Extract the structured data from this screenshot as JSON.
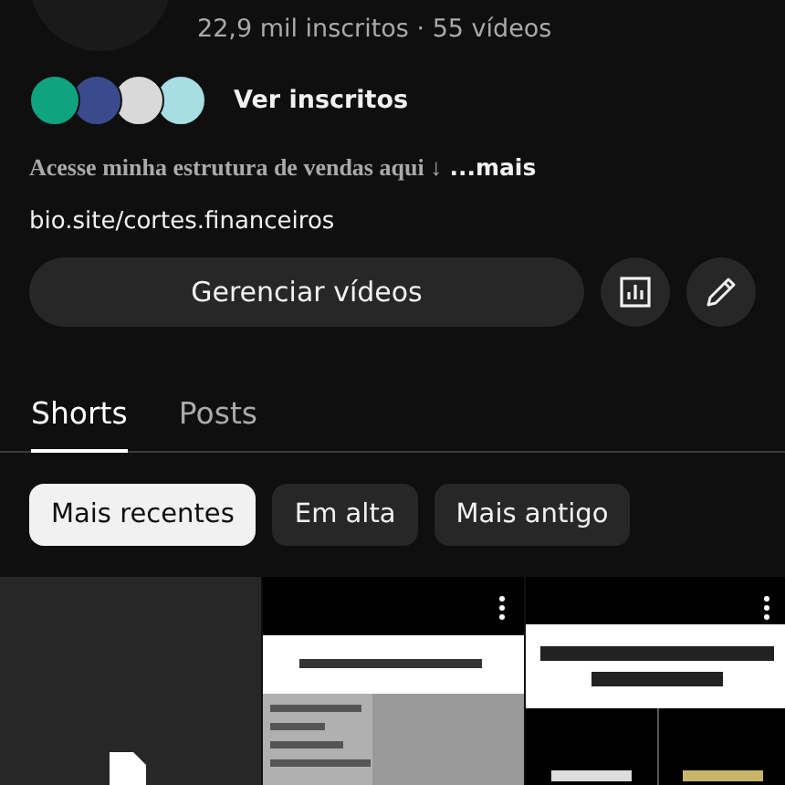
{
  "channel": {
    "stats": "22,9 mil inscritos · 55 vídeos"
  },
  "subscribers": {
    "avatars": [
      {
        "color": "#10a37f"
      },
      {
        "color": "#3b4a8c"
      },
      {
        "color": "#d9d9d9"
      },
      {
        "color": "#a8dde3"
      }
    ],
    "label": "Ver inscritos"
  },
  "description": {
    "text": "Acesse minha estrutura de vendas aqui ↓",
    "more": "...mais"
  },
  "link": "bio.site/cortes.financeiros",
  "actions": {
    "manage": "Gerenciar vídeos",
    "icon_buttons": [
      {
        "kind": "analytics"
      },
      {
        "kind": "edit"
      }
    ]
  },
  "tabs": [
    {
      "label": "Shorts",
      "selected": true
    },
    {
      "label": "Posts",
      "selected": false
    }
  ],
  "chips": [
    {
      "label": "Mais recentes",
      "selected": true
    },
    {
      "label": "Em alta",
      "selected": false
    },
    {
      "label": "Mais antigo",
      "selected": false
    }
  ],
  "shorts": [
    {
      "kind": "empty"
    },
    {
      "kind": "picture"
    },
    {
      "kind": "picture"
    }
  ]
}
